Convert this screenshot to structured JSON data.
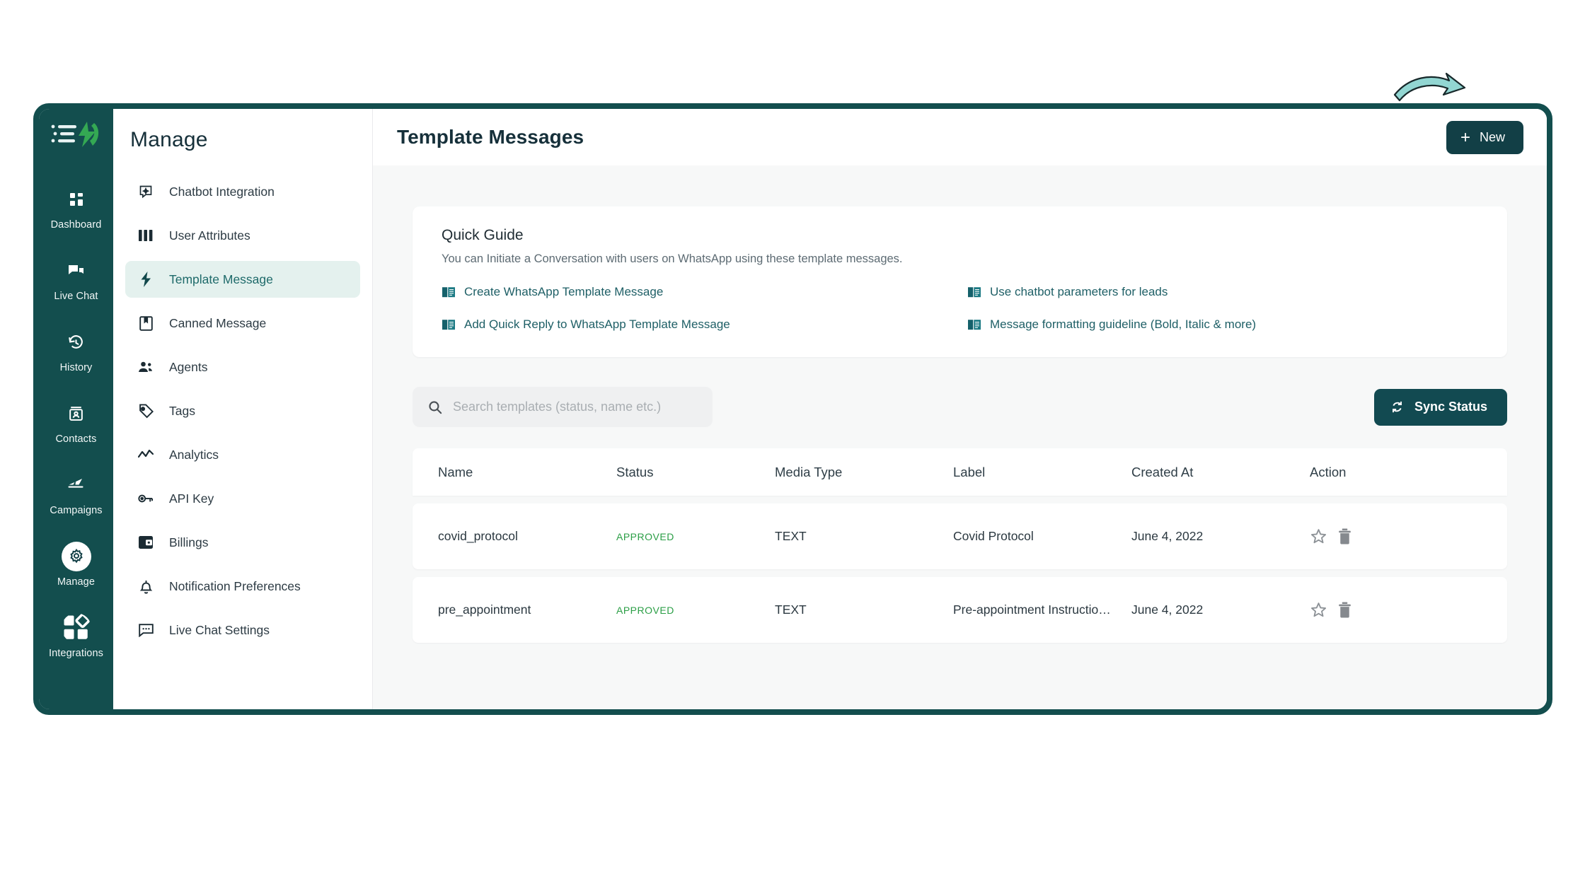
{
  "brand": {
    "logo_icon": "list-lightning-logo",
    "accent_green": "#3aa157",
    "shell_color": "#134e4e"
  },
  "icon_rail": {
    "items": [
      {
        "label": "Dashboard",
        "icon": "dashboard-grid-icon",
        "active": false
      },
      {
        "label": "Live Chat",
        "icon": "chat-bubbles-icon",
        "active": false
      },
      {
        "label": "History",
        "icon": "clock-rewind-icon",
        "active": false
      },
      {
        "label": "Contacts",
        "icon": "contact-card-icon",
        "active": false
      },
      {
        "label": "Campaigns",
        "icon": "airplane-icon",
        "active": false
      },
      {
        "label": "Manage",
        "icon": "gear-icon",
        "active": true
      },
      {
        "label": "Integrations",
        "icon": "integrations-icon",
        "active": false
      }
    ]
  },
  "sidebar": {
    "title": "Manage",
    "items": [
      {
        "label": "Chatbot Integration",
        "icon": "chatbot-icon",
        "active": false
      },
      {
        "label": "User Attributes",
        "icon": "columns-icon",
        "active": false
      },
      {
        "label": "Template Message",
        "icon": "lightning-bolt-icon",
        "active": true
      },
      {
        "label": "Canned Message",
        "icon": "bookmark-book-icon",
        "active": false
      },
      {
        "label": "Agents",
        "icon": "people-icon",
        "active": false
      },
      {
        "label": "Tags",
        "icon": "tag-icon",
        "active": false
      },
      {
        "label": "Analytics",
        "icon": "line-chart-icon",
        "active": false
      },
      {
        "label": "API Key",
        "icon": "key-icon",
        "active": false
      },
      {
        "label": "Billings",
        "icon": "wallet-icon",
        "active": false
      },
      {
        "label": "Notification Preferences",
        "icon": "bell-icon",
        "active": false
      },
      {
        "label": "Live Chat Settings",
        "icon": "chat-dots-icon",
        "active": false
      }
    ]
  },
  "header": {
    "title": "Template Messages",
    "new_button_label": "New",
    "new_button_icon": "plus-icon",
    "annotation_icon": "curved-arrow-pointing-to-new-button"
  },
  "quick_guide": {
    "title": "Quick Guide",
    "subtitle": "You can Initiate a Conversation with users on WhatsApp using these template messages.",
    "links": [
      {
        "label": "Create WhatsApp Template Message",
        "icon": "book-icon"
      },
      {
        "label": "Use chatbot parameters for leads",
        "icon": "book-icon"
      },
      {
        "label": "Add Quick Reply to WhatsApp Template Message",
        "icon": "book-icon"
      },
      {
        "label": "Message formatting guideline (Bold, Italic & more)",
        "icon": "book-icon"
      }
    ]
  },
  "toolbar": {
    "search_placeholder": "Search templates (status, name etc.)",
    "search_value": "",
    "search_icon": "search-icon",
    "sync_label": "Sync Status",
    "sync_icon": "sync-refresh-icon"
  },
  "table": {
    "columns": [
      "Name",
      "Status",
      "Media Type",
      "Label",
      "Created At",
      "Action"
    ],
    "rows": [
      {
        "name": "covid_protocol",
        "status": "APPROVED",
        "media_type": "TEXT",
        "label": "Covid Protocol",
        "created_at": "June 4, 2022",
        "actions": [
          "star-icon",
          "trash-icon"
        ]
      },
      {
        "name": "pre_appointment",
        "status": "APPROVED",
        "media_type": "TEXT",
        "label": "Pre-appointment Instructio…",
        "created_at": "June 4, 2022",
        "actions": [
          "star-icon",
          "trash-icon"
        ]
      }
    ]
  },
  "colors": {
    "teal_dark": "#134e4e",
    "teal_button": "#123f46",
    "active_menu_bg": "#e4f1ee",
    "status_green": "#2a9e45",
    "page_bg": "#f7f8f8",
    "annotation_arrow": "#8fd8d4"
  }
}
